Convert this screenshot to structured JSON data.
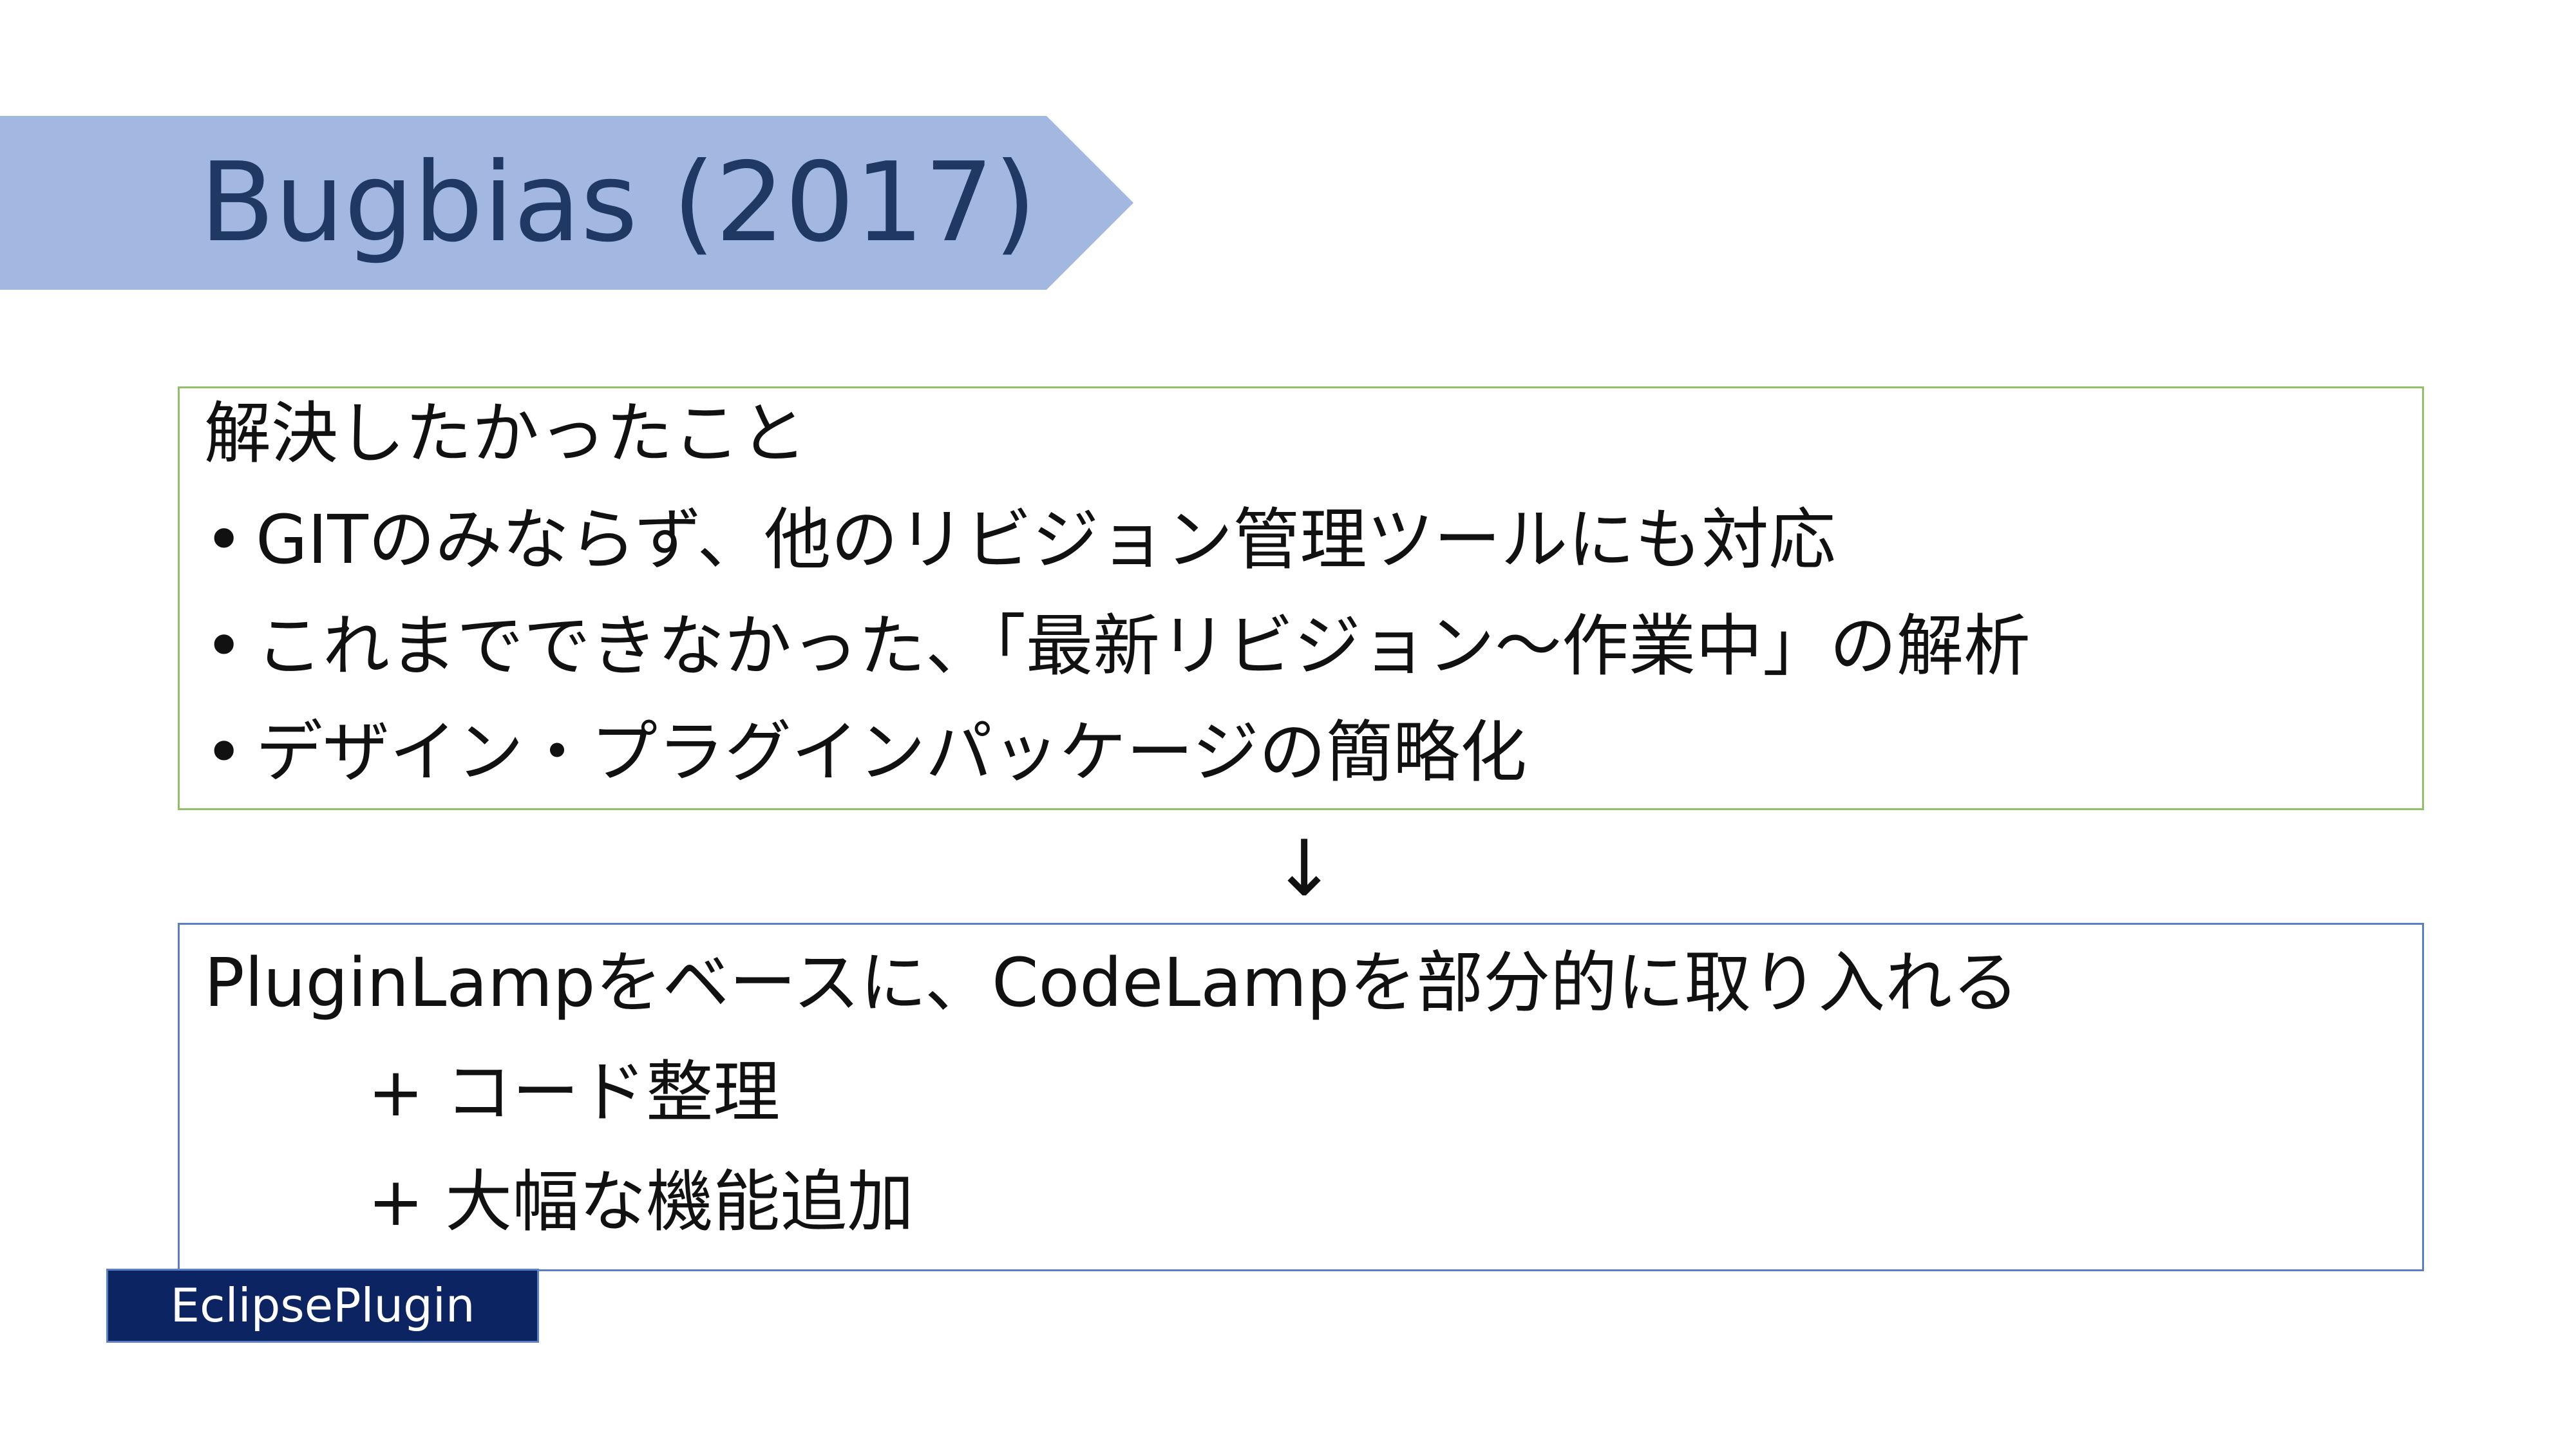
{
  "slide": {
    "title": "Bugbias (2017)",
    "problems": {
      "heading": "解決したかったこと",
      "bullet_char": "•",
      "items": [
        "GITのみならず、他のリビジョン管理ツールにも対応",
        "これまでできなかった、「最新リビジョン〜作業中」の解析",
        "デザイン・プラグインパッケージの簡略化"
      ]
    },
    "arrow": "↓",
    "solution": {
      "main": "PluginLampをベースに、CodeLampを部分的に取り入れる",
      "additions": [
        "+ コード整理",
        "+ 大幅な機能追加"
      ]
    },
    "tag": "EclipsePlugin"
  },
  "colors": {
    "banner_fill": "#a3b8e0",
    "title_text": "#203864",
    "problems_border": "#92c06a",
    "solution_border": "#5b7fc7",
    "tag_fill": "#0c2461",
    "tag_text": "#ffffff"
  }
}
